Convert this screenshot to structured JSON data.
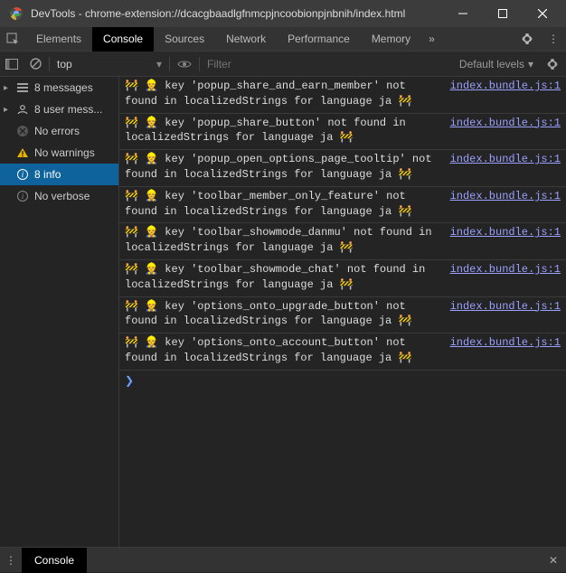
{
  "window": {
    "title": "DevTools - chrome-extension://dcacgbaadlgfnmcpjncoobionpjnbnih/index.html"
  },
  "tabs": {
    "elements": "Elements",
    "console": "Console",
    "sources": "Sources",
    "network": "Network",
    "performance": "Performance",
    "memory": "Memory"
  },
  "filterbar": {
    "context": "top",
    "filter_placeholder": "Filter",
    "levels": "Default levels"
  },
  "sidebar": {
    "messages": {
      "count": "8",
      "label": "messages"
    },
    "user": {
      "count": "8",
      "label": "user mess..."
    },
    "errors": {
      "label": "No errors"
    },
    "warnings": {
      "label": "No warnings"
    },
    "info": {
      "count": "8",
      "label": "info"
    },
    "verbose": {
      "label": "No verbose"
    }
  },
  "messages": [
    {
      "text": "🚧 👷 key 'popup_share_and_earn_member' not found in localizedStrings for language ja 🚧",
      "src": "index.bundle.js:1"
    },
    {
      "text": "🚧 👷 key 'popup_share_button' not found in localizedStrings for language ja 🚧",
      "src": "index.bundle.js:1"
    },
    {
      "text": "🚧 👷 key 'popup_open_options_page_tooltip' not found in localizedStrings for language ja 🚧",
      "src": "index.bundle.js:1"
    },
    {
      "text": "🚧 👷 key 'toolbar_member_only_feature' not found in localizedStrings for language ja 🚧",
      "src": "index.bundle.js:1"
    },
    {
      "text": "🚧 👷 key 'toolbar_showmode_danmu' not found in localizedStrings for language ja 🚧",
      "src": "index.bundle.js:1"
    },
    {
      "text": "🚧 👷 key 'toolbar_showmode_chat' not found in localizedStrings for language ja 🚧",
      "src": "index.bundle.js:1"
    },
    {
      "text": "🚧 👷 key 'options_onto_upgrade_button' not found in localizedStrings for language ja 🚧",
      "src": "index.bundle.js:1"
    },
    {
      "text": "🚧 👷 key 'options_onto_account_button' not found in localizedStrings for language ja 🚧",
      "src": "index.bundle.js:1"
    }
  ],
  "drawer": {
    "label": "Console"
  },
  "prompt": "❯"
}
